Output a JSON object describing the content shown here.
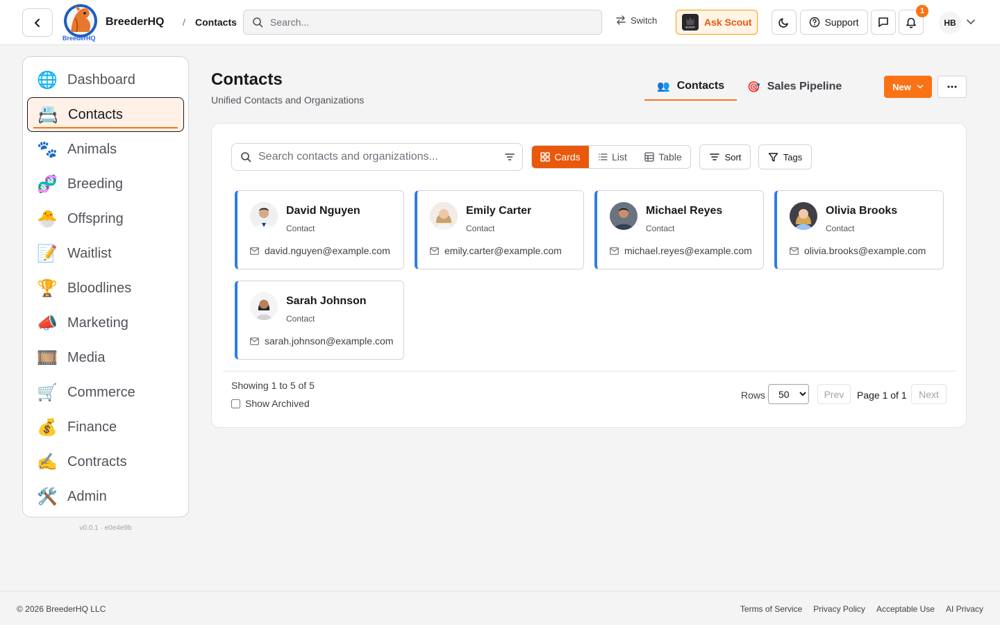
{
  "header": {
    "brand": "BreederHQ",
    "logo_sub": "BreederHQ",
    "breadcrumb_sep": "/",
    "breadcrumb": "Contacts",
    "search_placeholder": "Search...",
    "switch_label": "Switch",
    "scout_label": "Ask Scout",
    "scout_badge": "SCOUT",
    "support_label": "Support",
    "notification_count": "1",
    "avatar_initials": "HB"
  },
  "sidebar": {
    "items": [
      {
        "label": "Dashboard",
        "icon": "globe-icon",
        "glyph": "🌐"
      },
      {
        "label": "Contacts",
        "icon": "contacts-icon",
        "glyph": "📇",
        "active": true
      },
      {
        "label": "Animals",
        "icon": "paw-icon",
        "glyph": "🐾"
      },
      {
        "label": "Breeding",
        "icon": "dna-icon",
        "glyph": "🧬"
      },
      {
        "label": "Offspring",
        "icon": "hatching-chick-icon",
        "glyph": "🐣"
      },
      {
        "label": "Waitlist",
        "icon": "memo-icon",
        "glyph": "📝"
      },
      {
        "label": "Bloodlines",
        "icon": "trophy-icon",
        "glyph": "🏆"
      },
      {
        "label": "Marketing",
        "icon": "megaphone-icon",
        "glyph": "📣"
      },
      {
        "label": "Media",
        "icon": "film-icon",
        "glyph": "🎞️"
      },
      {
        "label": "Commerce",
        "icon": "cart-icon",
        "glyph": "🛒"
      },
      {
        "label": "Finance",
        "icon": "money-bag-icon",
        "glyph": "💰"
      },
      {
        "label": "Contracts",
        "icon": "writing-hand-icon",
        "glyph": "✍️"
      },
      {
        "label": "Admin",
        "icon": "tools-icon",
        "glyph": "🛠️"
      }
    ],
    "version": "v0.0.1 · e0e4e9b"
  },
  "page": {
    "title": "Contacts",
    "subtitle": "Unified Contacts and Organizations",
    "tabs": [
      {
        "label": "Contacts",
        "icon": "people-icon",
        "glyph": "👥",
        "active": true
      },
      {
        "label": "Sales Pipeline",
        "icon": "target-icon",
        "glyph": "🎯"
      }
    ],
    "new_label": "New"
  },
  "toolbar": {
    "search_placeholder": "Search contacts and organizations...",
    "views": [
      {
        "label": "Cards",
        "active": true
      },
      {
        "label": "List"
      },
      {
        "label": "Table"
      }
    ],
    "sort_label": "Sort",
    "tags_label": "Tags"
  },
  "contacts": [
    {
      "name": "David Nguyen",
      "role": "Contact",
      "email": "david.nguyen@example.com"
    },
    {
      "name": "Emily Carter",
      "role": "Contact",
      "email": "emily.carter@example.com"
    },
    {
      "name": "Michael Reyes",
      "role": "Contact",
      "email": "michael.reyes@example.com"
    },
    {
      "name": "Olivia Brooks",
      "role": "Contact",
      "email": "olivia.brooks@example.com"
    },
    {
      "name": "Sarah Johnson",
      "role": "Contact",
      "email": "sarah.johnson@example.com"
    }
  ],
  "pagination": {
    "showing": "Showing 1 to 5 of 5",
    "show_archived": "Show Archived",
    "rows_label": "Rows",
    "rows_value": "50",
    "prev": "Prev",
    "page_label": "Page 1 of 1",
    "next": "Next"
  },
  "footer": {
    "copyright": "© 2026 BreederHQ LLC",
    "links": [
      "Terms of Service",
      "Privacy Policy",
      "Acceptable Use",
      "AI Privacy"
    ]
  },
  "colors": {
    "accent": "#f97316",
    "card_border": "#2f7de1"
  }
}
